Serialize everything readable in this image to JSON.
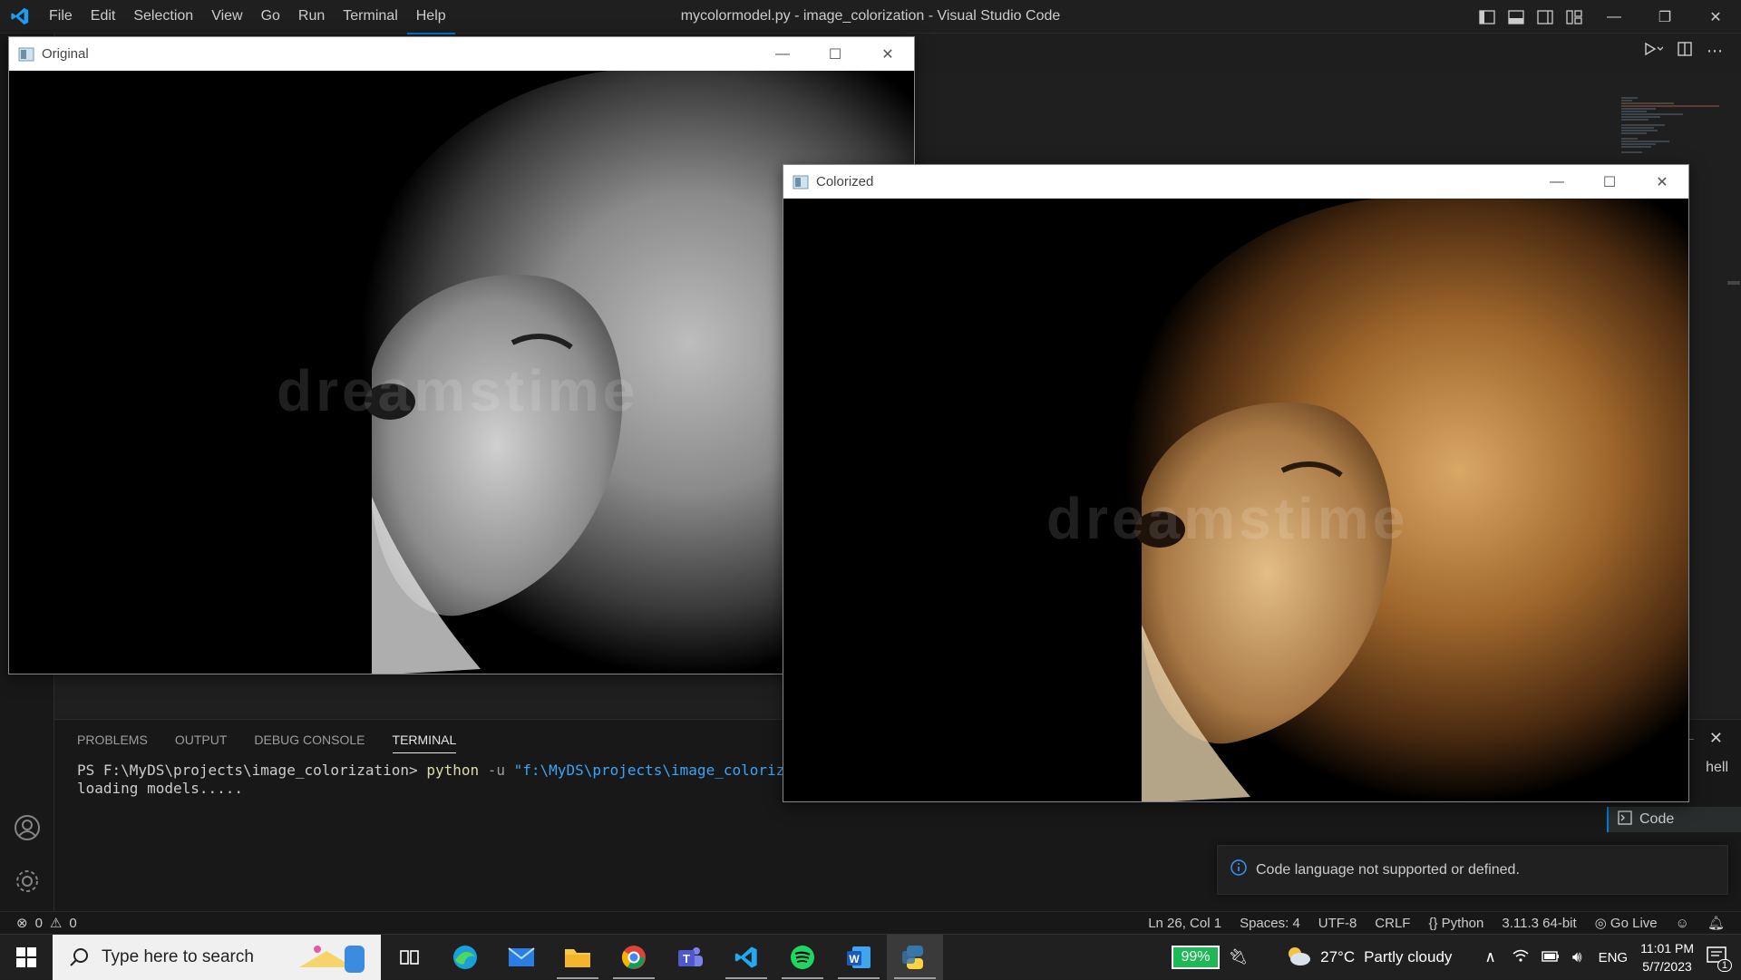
{
  "vscode": {
    "title": "mycolormodel.py - image_colorization - Visual Studio Code",
    "menu": [
      "File",
      "Edit",
      "Selection",
      "View",
      "Go",
      "Run",
      "Terminal",
      "Help"
    ],
    "panel": {
      "tabs": [
        "PROBLEMS",
        "OUTPUT",
        "DEBUG CONSOLE",
        "TERMINAL"
      ],
      "active_tab": "TERMINAL",
      "terminal": {
        "prompt": "PS F:\\MyDS\\projects\\image_colorization> ",
        "command": "python",
        "flag": " -u ",
        "arg": "\"f:\\MyDS\\projects\\image_colorization\\",
        "output": "loading models.....",
        "side_text": "hell",
        "list_item": "Code"
      }
    },
    "notification": "Code language not supported or defined.",
    "status": {
      "errors": "0",
      "warnings": "0",
      "position": "Ln 26, Col 1",
      "spaces": "Spaces: 4",
      "encoding": "UTF-8",
      "eol": "CRLF",
      "language": "Python",
      "interpreter": "3.11.3 64-bit",
      "golive": "Go Live"
    }
  },
  "windows": {
    "original": {
      "title": "Original",
      "watermark": "dreamstime"
    },
    "colorized": {
      "title": "Colorized",
      "watermark": "dreamstime"
    }
  },
  "taskbar": {
    "search_placeholder": "Type here to search",
    "apps": [
      "task-view",
      "edge",
      "mail",
      "file-explorer",
      "chrome",
      "teams",
      "vscode",
      "spotify",
      "word",
      "python"
    ],
    "battery": "99%",
    "weather_temp": "27°C",
    "weather_desc": "Partly cloudy",
    "language": "ENG",
    "time": "11:01 PM",
    "date": "5/7/2023",
    "notification_count": "1"
  }
}
